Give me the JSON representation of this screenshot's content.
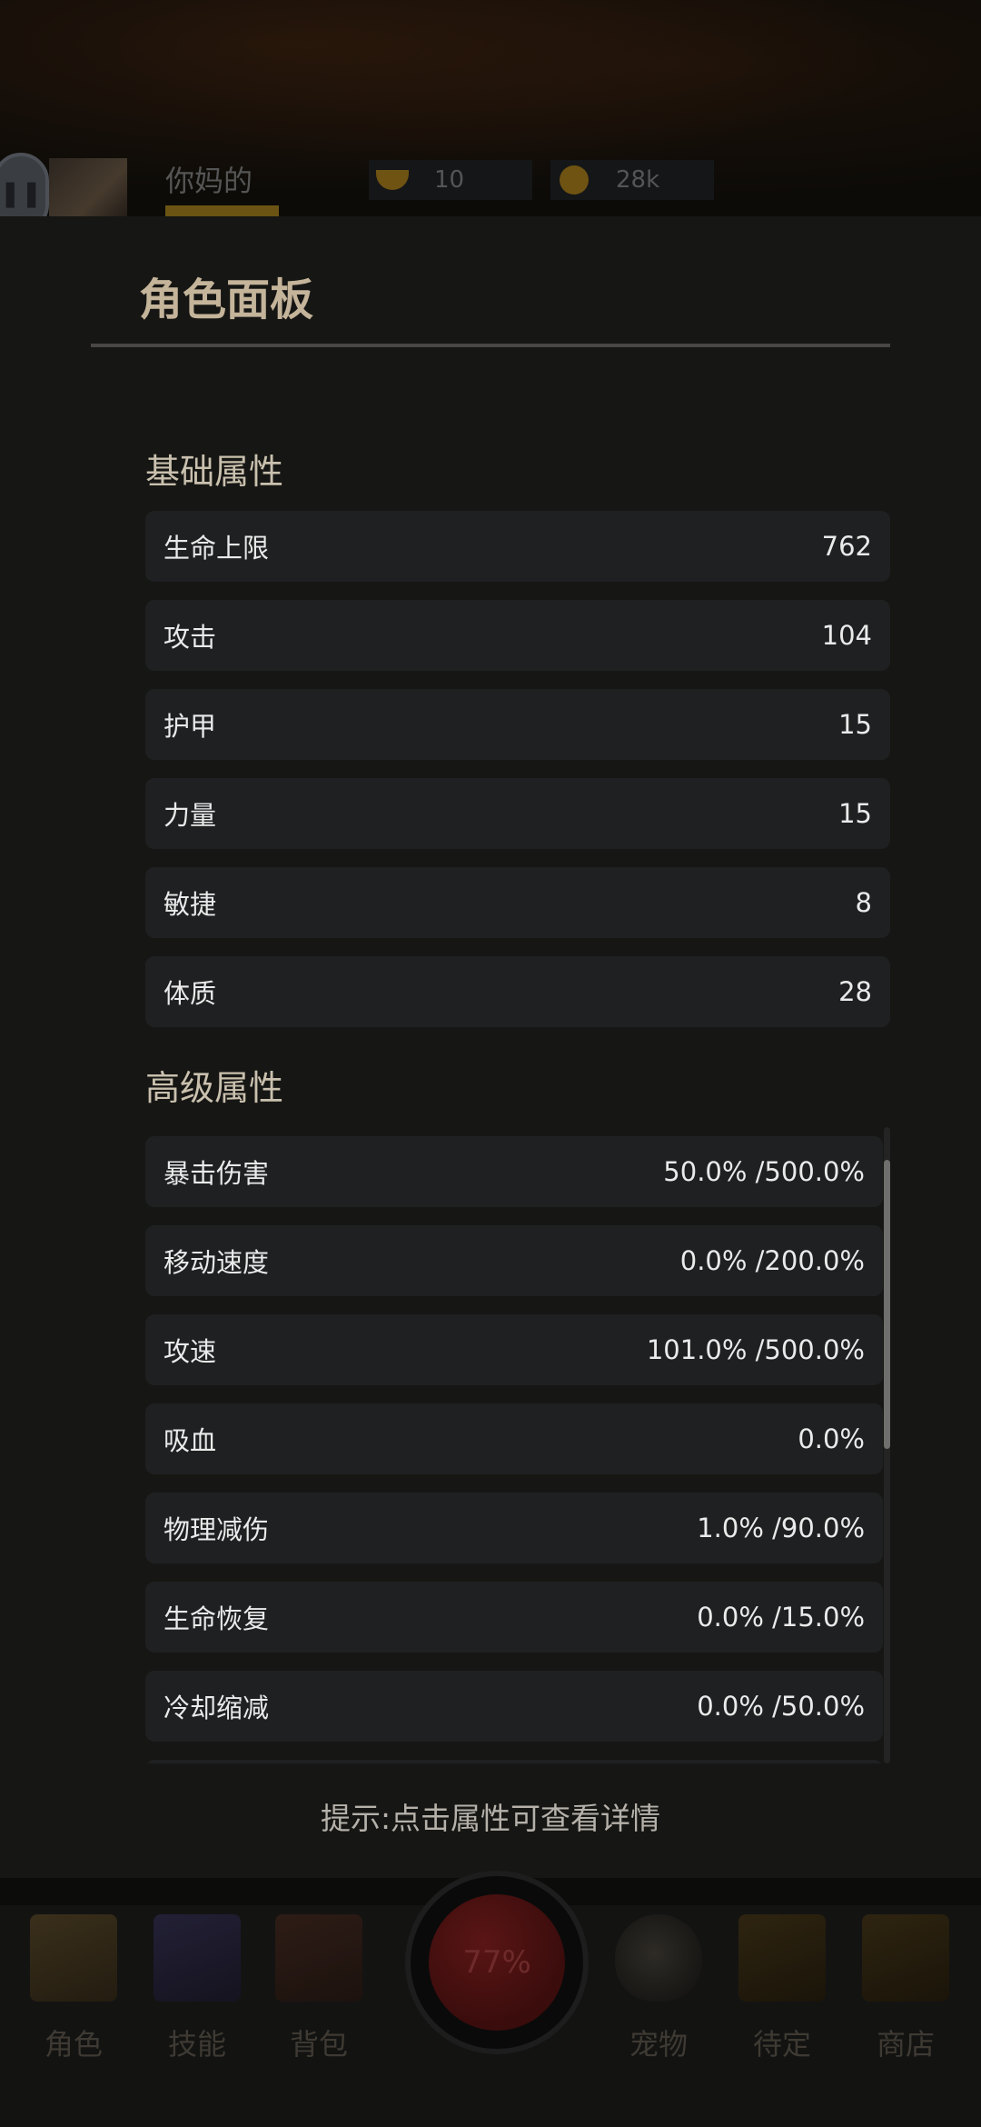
{
  "hud": {
    "player_name": "你妈的",
    "gold_ingots": "10",
    "coins": "28k"
  },
  "panel": {
    "title": "角色面板",
    "basic_heading": "基础属性",
    "basic_stats": [
      {
        "label": "生命上限",
        "value": "762"
      },
      {
        "label": "攻击",
        "value": "104"
      },
      {
        "label": "护甲",
        "value": "15"
      },
      {
        "label": "力量",
        "value": "15"
      },
      {
        "label": "敏捷",
        "value": "8"
      },
      {
        "label": "体质",
        "value": "28"
      }
    ],
    "advanced_heading": "高级属性",
    "advanced_stats": [
      {
        "label": "暴击伤害",
        "value": "50.0% /500.0%"
      },
      {
        "label": "移动速度",
        "value": "0.0% /200.0%"
      },
      {
        "label": "攻速",
        "value": "101.0% /500.0%"
      },
      {
        "label": "吸血",
        "value": "0.0%"
      },
      {
        "label": "物理减伤",
        "value": "1.0% /90.0%"
      },
      {
        "label": "生命恢复",
        "value": "0.0% /15.0%"
      },
      {
        "label": "冷却缩减",
        "value": "0.0% /50.0%"
      }
    ],
    "hint": "提示:点击属性可查看详情"
  },
  "bottom_nav": {
    "items": [
      {
        "label": "角色",
        "icon": "tent-icon"
      },
      {
        "label": "技能",
        "icon": "skill-book-icon"
      },
      {
        "label": "背包",
        "icon": "backpack-icon"
      },
      {
        "label": "宠物",
        "icon": "egg-icon"
      },
      {
        "label": "待定",
        "icon": "chest-icon"
      },
      {
        "label": "商店",
        "icon": "shop-chest-icon"
      }
    ],
    "center_progress": "77%"
  }
}
